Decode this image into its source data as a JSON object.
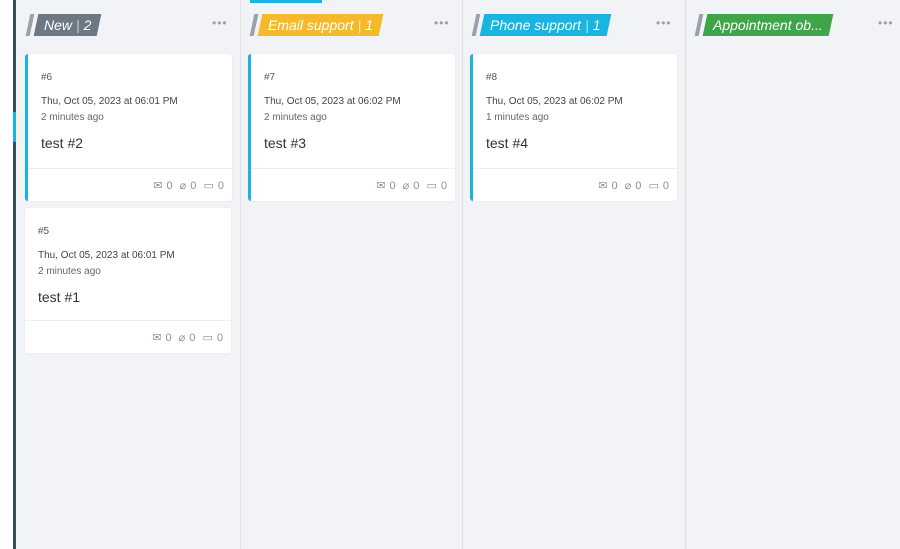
{
  "columns": [
    {
      "name": "New",
      "count": "2",
      "color": "#6d7884",
      "more": "•••"
    },
    {
      "name": "Email support",
      "count": "1",
      "color": "#f5b92c",
      "more": "•••"
    },
    {
      "name": "Phone support",
      "count": "1",
      "color": "#19b5e0",
      "more": "•••"
    },
    {
      "name": "Appointment ob...",
      "color": "#3ea648",
      "more": "•••"
    }
  ],
  "cards": [
    {
      "num": "#6",
      "date": "Thu, Oct 05, 2023 at 06:01 PM",
      "ago": "2 minutes ago",
      "title": "test #2",
      "mail": "0",
      "attach": "0",
      "note": "0"
    },
    {
      "num": "#5",
      "date": "Thu, Oct 05, 2023 at 06:01 PM",
      "ago": "2 minutes ago",
      "title": "test #1",
      "mail": "0",
      "attach": "0",
      "note": "0"
    },
    {
      "num": "#7",
      "date": "Thu, Oct 05, 2023 at 06:02 PM",
      "ago": "2 minutes ago",
      "title": "test #3",
      "mail": "0",
      "attach": "0",
      "note": "0"
    },
    {
      "num": "#8",
      "date": "Thu, Oct 05, 2023 at 06:02 PM",
      "ago": "1 minutes ago",
      "title": "test #4",
      "mail": "0",
      "attach": "0",
      "note": "0"
    }
  ],
  "icons": {
    "mail": "mail-icon",
    "attach": "paperclip-icon",
    "note": "note-icon",
    "more": "more-icon"
  }
}
